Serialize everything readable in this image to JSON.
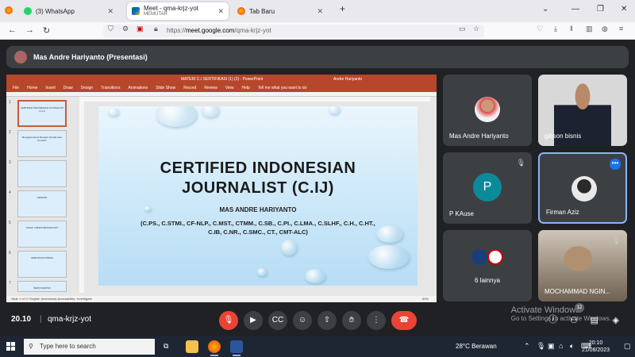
{
  "browser": {
    "tabs": [
      {
        "label": "(3) WhatsApp",
        "sub": ""
      },
      {
        "label": "Meet - qma-krjz-yot",
        "sub": "MEMUTAR"
      },
      {
        "label": "Tab Baru",
        "sub": ""
      }
    ],
    "url_prefix": "https://",
    "url_host": "meet.google.com",
    "url_path": "/qma-krjz-yot"
  },
  "meet": {
    "presenter_label": "Mas Andre Hariyanto (Presentasi)",
    "time": "20.10",
    "meeting_code": "qma-krjz-yot",
    "participants": [
      {
        "name": "Mas Andre Hariyanto"
      },
      {
        "name": "gibson bisnis"
      },
      {
        "name": "P KAuse",
        "initial": "P"
      },
      {
        "name": "Firman Aziz"
      },
      {
        "name": "6 lainnya"
      },
      {
        "name": "MOCHAMMAD NGIN..."
      }
    ],
    "people_count": "12",
    "watermark_title": "Activate Windows",
    "watermark_sub": "Go to Settings to activate Windows."
  },
  "ppt": {
    "window_title": "MATERI C.I SERTIFIKASI (1) (2) - PowerPoint",
    "user": "Andre Hariyanto",
    "menu": [
      "File",
      "Home",
      "Insert",
      "Draw",
      "Design",
      "Transitions",
      "Animations",
      "Slide Show",
      "Record",
      "Review",
      "View",
      "Help",
      "Tell me what you want to do"
    ],
    "status": "Slide 1 of 17    English (Indonesia)    Accessibility: Investigate",
    "zoom": "60%",
    "slide": {
      "title_line1": "CERTIFIED INDONESIAN",
      "title_line2": "JOURNALIST (C.IJ)",
      "author": "MAS ANDRE HARIYANTO",
      "credentials": "(C.PS., C.STMI., CF-NLP., C.MST., CTMM., C.SB., C.PI., C.LMA., C.SLHF., C.H., C.HT., C.IB, C.NR., C.SMC., CT., CMT-ALC)"
    },
    "thumb_labels": [
      "CERTIFIED INDONESIAN JOURNALIST (C.IJ)",
      "Mengapa Harus Menjadi Jurnalis atau Penulis?",
      "",
      "DEFINISI",
      "SIGAP | MEDIA BROADCAST",
      "KEBIJAKAN PRESS",
      "PERSYARATAN"
    ]
  },
  "taskbar": {
    "search_placeholder": "Type here to search",
    "weather": "28°C  Berawan",
    "clock_time": "20:10",
    "clock_date": "21/08/2023"
  }
}
